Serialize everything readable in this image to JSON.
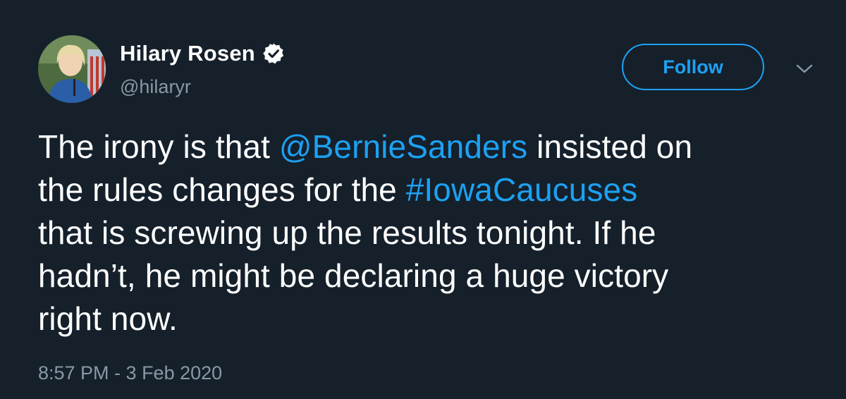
{
  "author": {
    "display_name": "Hilary Rosen",
    "handle": "@hilaryr",
    "verified": true,
    "avatar_icon": "profile-photo"
  },
  "actions": {
    "follow_label": "Follow",
    "menu_icon": "chevron-down-icon"
  },
  "tweet": {
    "line1_pre": "The irony is that ",
    "mention": "@BernieSanders",
    "line1_post": " insisted on",
    "line2_pre": "the rules changes for the ",
    "hashtag": "#IowaCaucuses",
    "line3": " that is screwing up the results tonight. If he",
    "line4": "hadn’t, he might be declaring a huge victory",
    "line5": "right now."
  },
  "meta": {
    "timestamp": "8:57 PM - 3 Feb 2020"
  },
  "colors": {
    "background": "#15202b",
    "accent": "#1da1f2",
    "secondary_text": "#8899a6",
    "primary_text": "#ffffff"
  }
}
